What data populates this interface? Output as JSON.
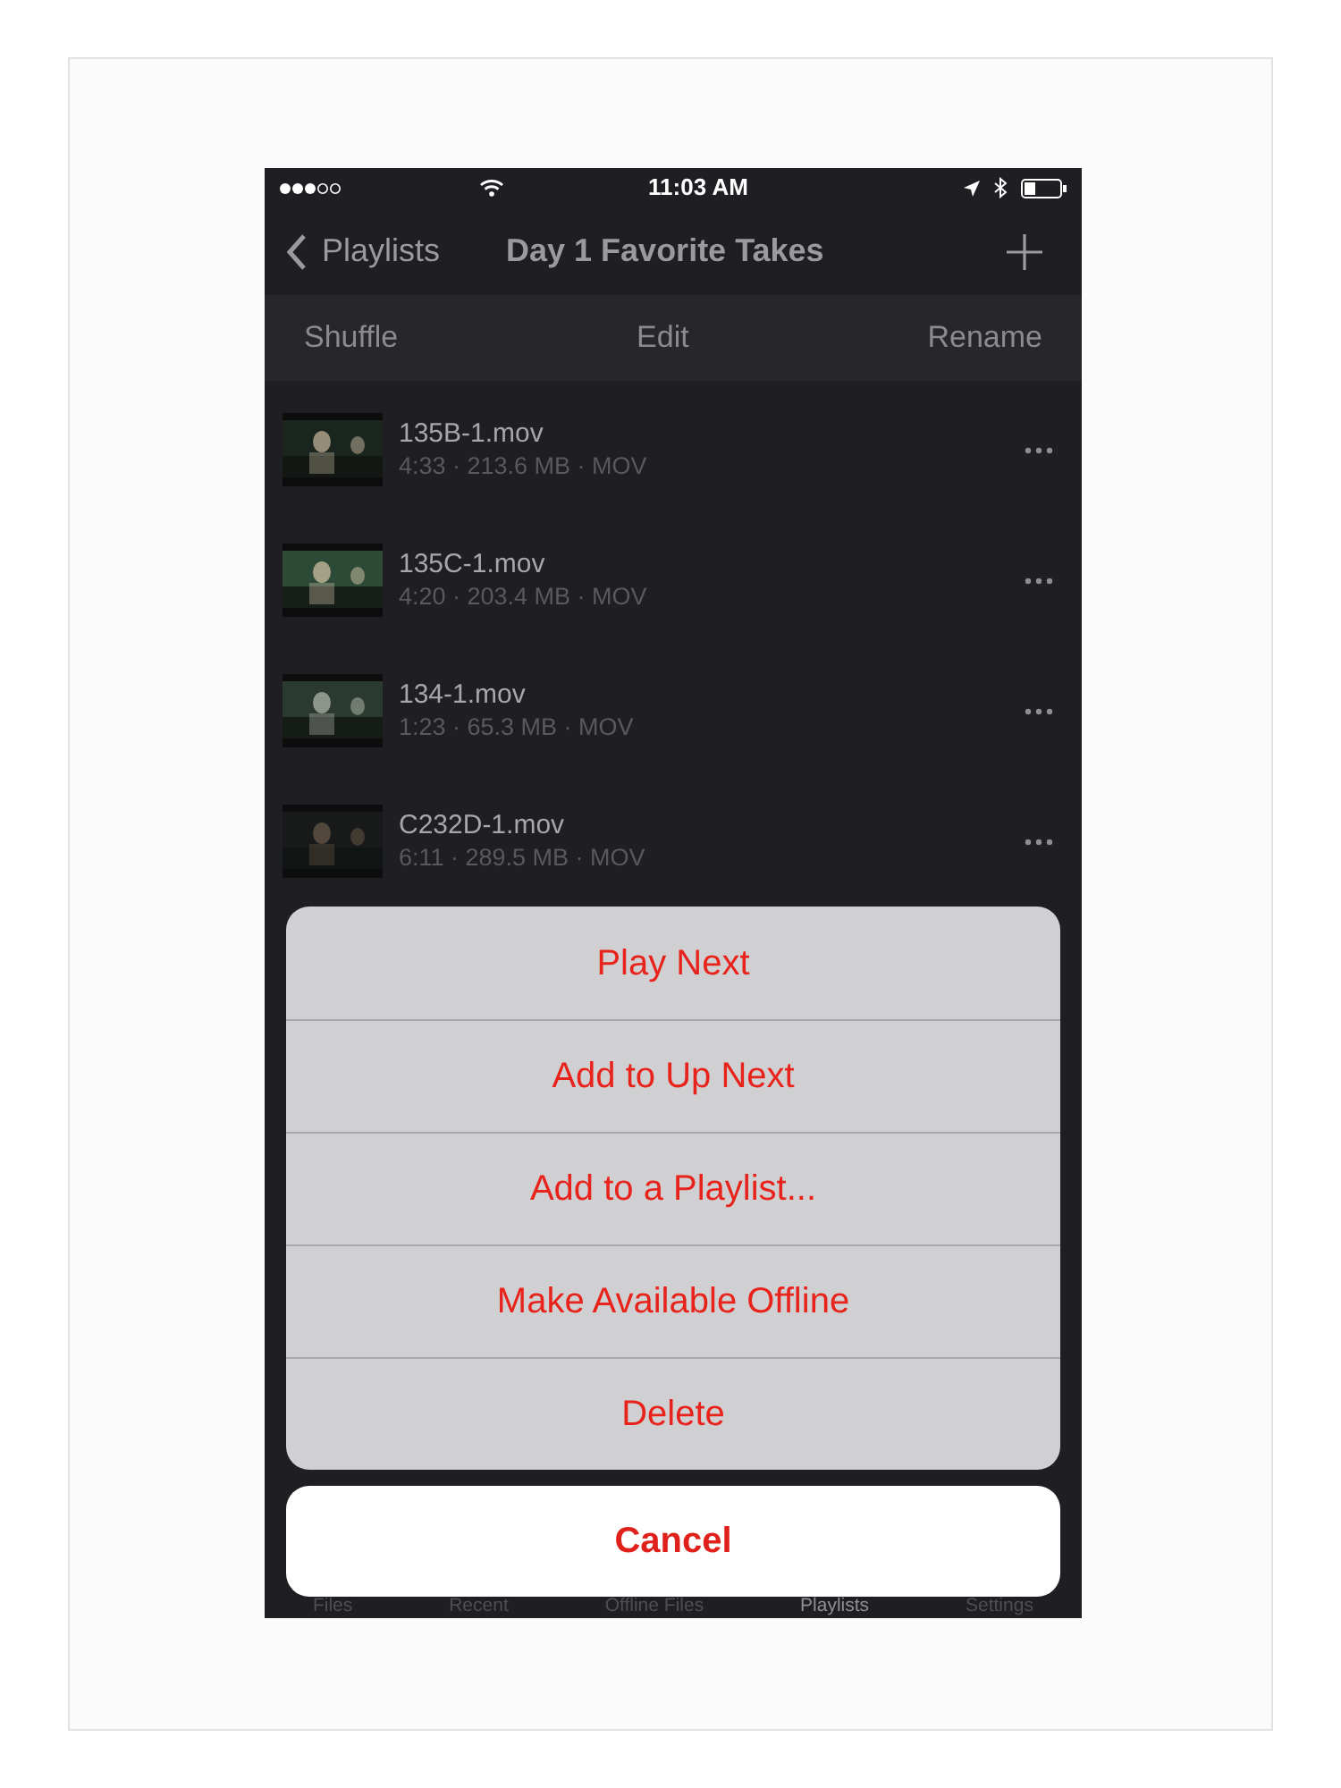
{
  "status_bar": {
    "time": "11:03 AM"
  },
  "nav": {
    "back": "Playlists",
    "title": "Day 1 Favorite Takes"
  },
  "toolbar": [
    "Shuffle",
    "Edit",
    "Rename"
  ],
  "files": [
    {
      "name": "135B-1.mov",
      "details": "4:33 · 213.6 MB · MOV"
    },
    {
      "name": "135C-1.mov",
      "details": "4:20 · 203.4 MB · MOV"
    },
    {
      "name": "134-1.mov",
      "details": "1:23 · 65.3 MB · MOV"
    },
    {
      "name": "C232D-1.mov",
      "details": "6:11 · 289.5 MB · MOV"
    }
  ],
  "actions": [
    "Play Next",
    "Add to Up Next",
    "Add to a Playlist...",
    "Make Available Offline",
    "Delete"
  ],
  "cancel": "Cancel",
  "tabs": [
    {
      "label": "Files",
      "selected": false
    },
    {
      "label": "Recent",
      "selected": false
    },
    {
      "label": "Offline Files",
      "selected": false
    },
    {
      "label": "Playlists",
      "selected": true
    },
    {
      "label": "Settings",
      "selected": false
    }
  ]
}
